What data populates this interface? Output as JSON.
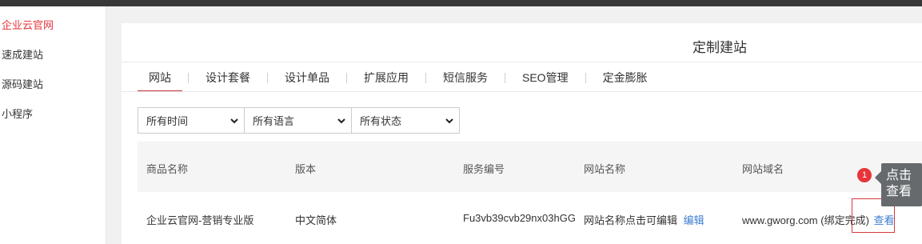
{
  "sidebar": {
    "items": [
      {
        "label": "企业云官网"
      },
      {
        "label": "速成建站"
      },
      {
        "label": "源码建站"
      },
      {
        "label": "小程序"
      }
    ]
  },
  "panel": {
    "title": "定制建站",
    "tabs": [
      {
        "label": "网站"
      },
      {
        "label": "设计套餐"
      },
      {
        "label": "设计单品"
      },
      {
        "label": "扩展应用"
      },
      {
        "label": "短信服务"
      },
      {
        "label": "SEO管理"
      },
      {
        "label": "定金膨胀"
      }
    ],
    "filters": [
      {
        "value": "所有时间"
      },
      {
        "value": "所有语言"
      },
      {
        "value": "所有状态"
      }
    ],
    "table": {
      "headers": [
        "商品名称",
        "版本",
        "服务编号",
        "网站名称",
        "网站域名"
      ],
      "rows": [
        {
          "product": "企业云官网-营销专业版",
          "version": "中文简体",
          "service_no": "Fu3vb39cvb29nx03hGG",
          "site_name": "网站名称点击可编辑",
          "edit_link": "编辑",
          "domain": "www.gworg.com (绑定完成)",
          "view_link": "查看"
        }
      ]
    }
  },
  "guide": {
    "step_number": "1",
    "tooltip_line1": "点击",
    "tooltip_line2": "查看"
  },
  "colors": {
    "accent_red": "#e5343d",
    "link_blue": "#3d7ed1",
    "tooltip_bg": "#666a6d"
  }
}
